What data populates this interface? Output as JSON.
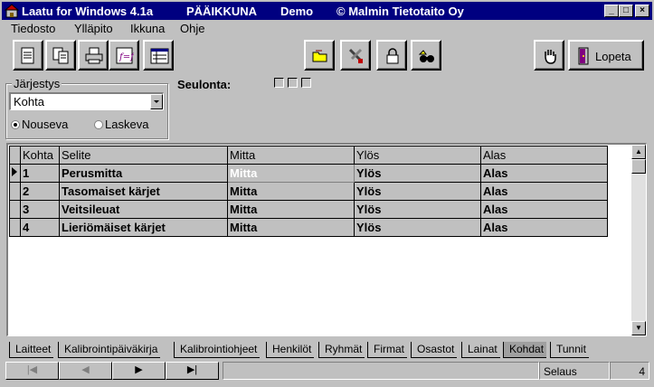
{
  "window": {
    "title_app": "Laatu for Windows 4.1a",
    "title_screen": "PÄÄIKKUNA",
    "title_mode": "Demo",
    "title_company": "© Malmin Tietotaito Oy"
  },
  "menu": [
    "Tiedosto",
    "Ylläpito",
    "Ikkuna",
    "Ohje"
  ],
  "toolbar": {
    "quit_label": "Lopeta"
  },
  "sort": {
    "group_label": "Järjestys",
    "selected": "Kohta",
    "asc_label": "Nouseva",
    "desc_label": "Laskeva"
  },
  "filter": {
    "label": "Seulonta:"
  },
  "table": {
    "columns": [
      "Kohta",
      "Selite",
      "Mitta",
      "Ylös",
      "Alas"
    ],
    "rows": [
      [
        "1",
        "Perusmitta",
        "Mitta",
        "Ylös",
        "Alas"
      ],
      [
        "2",
        "Tasomaiset kärjet",
        "Mitta",
        "Ylös",
        "Alas"
      ],
      [
        "3",
        "Veitsileuat",
        "Mitta",
        "Ylös",
        "Alas"
      ],
      [
        "4",
        "Lieriömäiset kärjet",
        "Mitta",
        "Ylös",
        "Alas"
      ]
    ]
  },
  "tabs": [
    "Laitteet",
    "Kalibrointipäiväkirja",
    "Kalibrointiohjeet",
    "Henkilöt",
    "Ryhmät",
    "Firmat",
    "Osastot",
    "Lainat",
    "Kohdat",
    "Tunnit"
  ],
  "active_tab": "Kohdat",
  "status": {
    "mode": "Selaus",
    "count": "4"
  },
  "colors": {
    "titlebar": "#000080",
    "face": "#c0c0c0"
  }
}
